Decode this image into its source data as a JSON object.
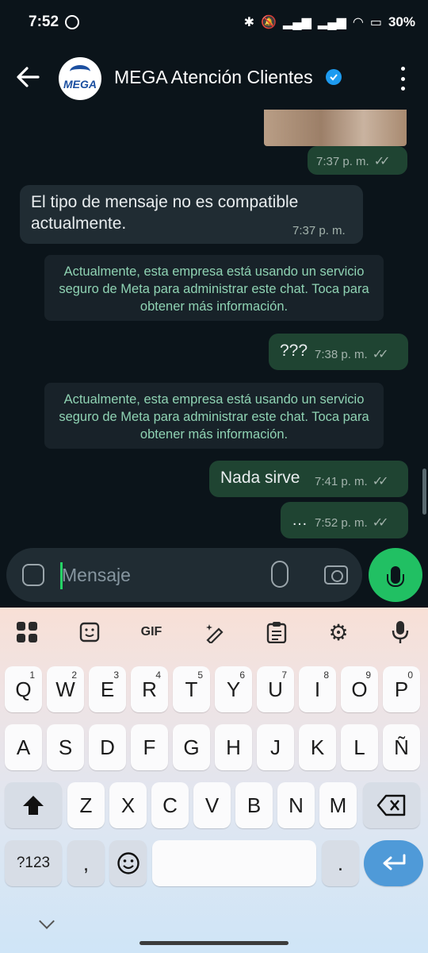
{
  "status_bar": {
    "time": "7:52",
    "battery": "30%"
  },
  "header": {
    "title": "MEGA Atención Clientes",
    "avatar_logo": "MEGA"
  },
  "messages": {
    "out1": {
      "time": "7:37 p. m."
    },
    "in1": {
      "text": "El tipo de mensaje no es compatible actualmente.",
      "time": "7:37 p. m."
    },
    "sys1": {
      "text": "Actualmente, esta empresa está usando un servicio seguro de Meta para administrar este chat. Toca para obtener más información."
    },
    "out2": {
      "text": "???",
      "time": "7:38 p. m."
    },
    "sys2": {
      "text": "Actualmente, esta empresa está usando un servicio seguro de Meta para administrar este chat. Toca para obtener más información."
    },
    "out3": {
      "text": "Nada sirve",
      "time": "7:41 p. m."
    },
    "out4": {
      "text": "…",
      "time": "7:52 p. m."
    }
  },
  "composer": {
    "placeholder": "Mensaje"
  },
  "keyboard": {
    "toolbar": {
      "gif": "GIF"
    },
    "row1": [
      {
        "k": "Q",
        "h": "1"
      },
      {
        "k": "W",
        "h": "2"
      },
      {
        "k": "E",
        "h": "3"
      },
      {
        "k": "R",
        "h": "4"
      },
      {
        "k": "T",
        "h": "5"
      },
      {
        "k": "Y",
        "h": "6"
      },
      {
        "k": "U",
        "h": "7"
      },
      {
        "k": "I",
        "h": "8"
      },
      {
        "k": "O",
        "h": "9"
      },
      {
        "k": "P",
        "h": "0"
      }
    ],
    "row2": [
      "A",
      "S",
      "D",
      "F",
      "G",
      "H",
      "J",
      "K",
      "L",
      "Ñ"
    ],
    "row3": [
      "Z",
      "X",
      "C",
      "V",
      "B",
      "N",
      "M"
    ],
    "symbols": "?123",
    "comma": ",",
    "period": "."
  },
  "colors": {
    "accent": "#21c063",
    "bubble_out": "#1f4432",
    "bubble_in": "#202c33",
    "system_text": "#8fd3b3"
  }
}
